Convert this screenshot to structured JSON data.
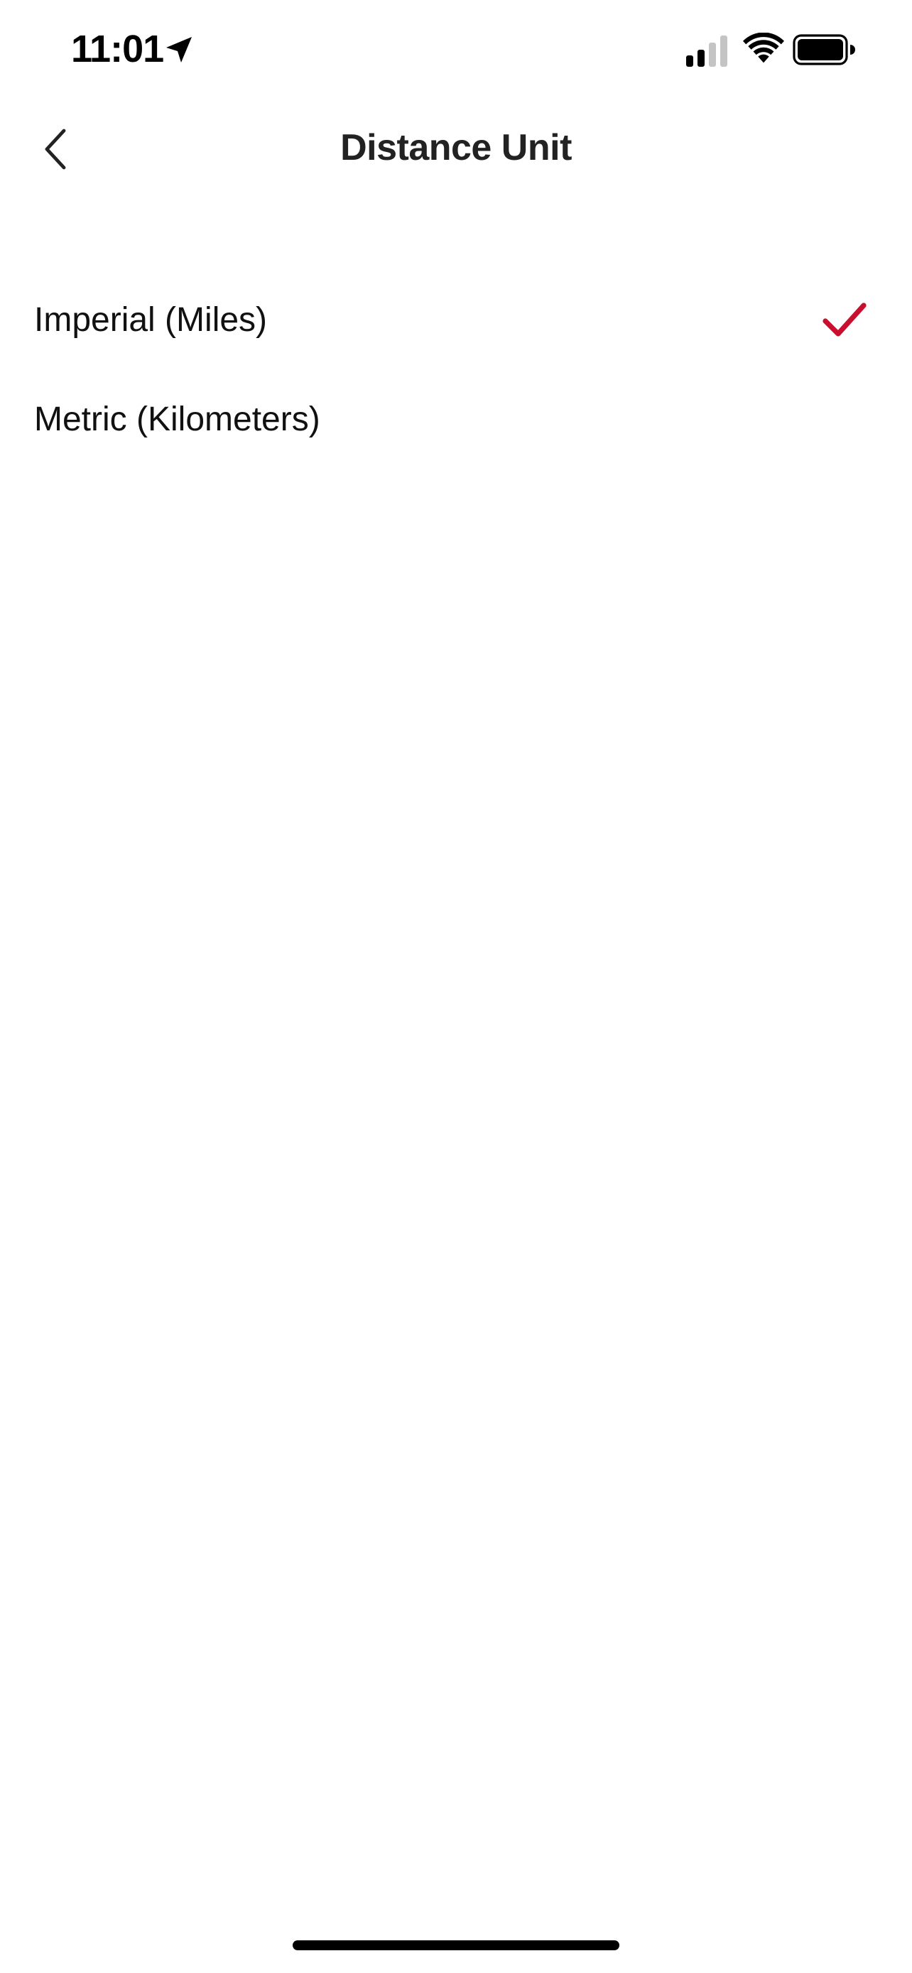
{
  "status_bar": {
    "time": "11:01",
    "icons": [
      "location-arrow-icon",
      "cellular-signal-icon",
      "wifi-icon",
      "battery-icon"
    ]
  },
  "nav": {
    "title": "Distance Unit",
    "back_icon": "chevron-left-icon"
  },
  "options": [
    {
      "label": "Imperial (Miles)",
      "selected": true
    },
    {
      "label": "Metric (Kilometers)",
      "selected": false
    }
  ],
  "colors": {
    "accent": "#C8102E",
    "text": "#111111",
    "background": "#FFFFFF"
  }
}
